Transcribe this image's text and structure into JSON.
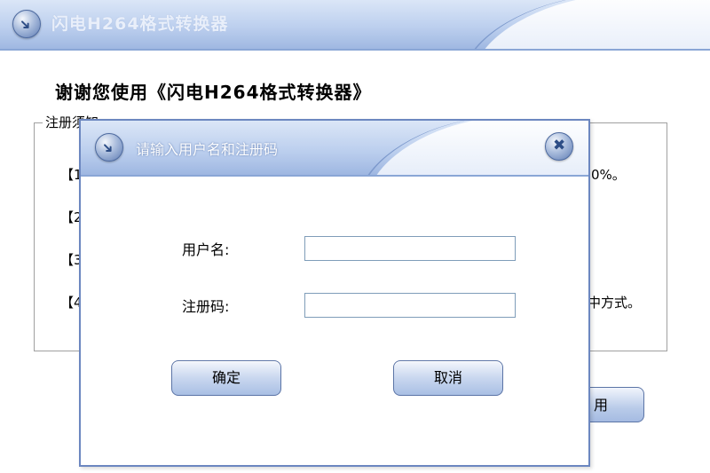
{
  "main_window": {
    "title": "闪电H264格式转换器",
    "heading": "谢谢您使用《闪电H264格式转换器》",
    "notes_legend": "注册须知",
    "notes": [
      {
        "prefix": "【1",
        "suffix": "0%。"
      },
      {
        "prefix": "【2",
        "suffix": ""
      },
      {
        "prefix": "【3",
        "suffix": ""
      },
      {
        "prefix": "【4",
        "suffix": "中方式。"
      }
    ],
    "use_button_label": "用"
  },
  "dialog": {
    "title": "请输入用户名和注册码",
    "username_label": "用户名:",
    "username_value": "",
    "regcode_label": "注册码:",
    "regcode_value": "",
    "ok_label": "确定",
    "cancel_label": "取消"
  },
  "icons": {
    "app": "arrow-circle-icon",
    "close": "close-icon"
  },
  "colors": {
    "titlebar": "#bccfee",
    "border": "#6c87c0",
    "button": "#c9d7ef"
  }
}
